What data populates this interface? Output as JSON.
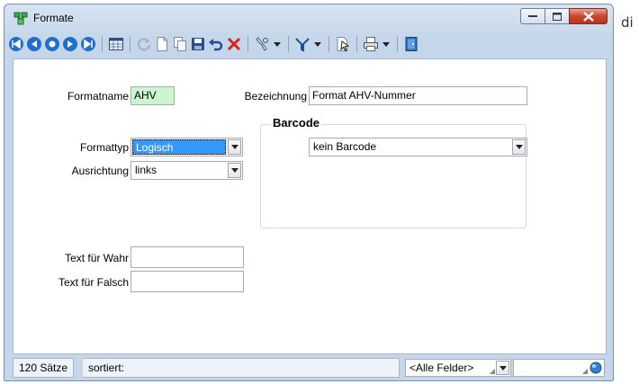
{
  "window": {
    "title": "Formate",
    "minimize_icon": "minimize-icon",
    "maximize_icon": "maximize-icon",
    "close_icon": "close-icon"
  },
  "outside_text": "di",
  "toolbar": {
    "icons": [
      "first-record-icon",
      "previous-record-icon",
      "next-page-icon",
      "next-record-icon",
      "last-record-icon",
      "table-view-icon",
      "refresh-icon",
      "new-record-icon",
      "copy-record-icon",
      "save-icon",
      "undo-icon",
      "delete-icon",
      "tools-icon",
      "filter-icon",
      "export-icon",
      "print-icon",
      "exit-icon"
    ]
  },
  "form": {
    "formatname_label": "Formatname",
    "formatname_value": "AHV",
    "bezeichnung_label": "Bezeichnung",
    "bezeichnung_value": "Format AHV-Nummer",
    "formattyp_label": "Formattyp",
    "formattyp_value": "Logisch",
    "ausrichtung_label": "Ausrichtung",
    "ausrichtung_value": "links",
    "barcode_title": "Barcode",
    "barcode_value": "kein Barcode",
    "text_wahr_label": "Text für Wahr",
    "text_wahr_value": "",
    "text_falsch_label": "Text für Falsch",
    "text_falsch_value": ""
  },
  "status": {
    "count": "120 Sätze",
    "sorted_label": "sortiert:",
    "field_filter": "<Alle Felder>",
    "search_value": ""
  },
  "colors": {
    "formatname_bg": "#cdf5cd",
    "selected_bg": "#3399ff",
    "nav_blue": "#1f6fd0",
    "delete_red": "#d9261c"
  }
}
